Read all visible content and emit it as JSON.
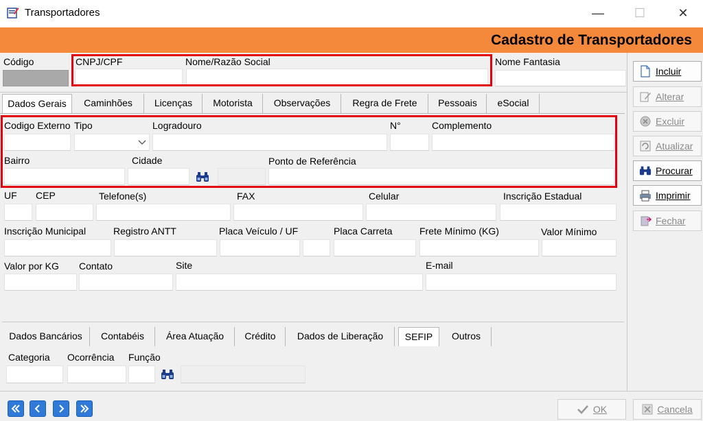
{
  "window": {
    "title": "Transportadores",
    "minimize": "—",
    "maximize": "☐",
    "close": "✕"
  },
  "header": {
    "title": "Cadastro de Transportadores"
  },
  "top_fields": {
    "codigo": "Código",
    "cnpj": "CNPJ/CPF",
    "nome": "Nome/Razão Social",
    "fantasia": "Nome Fantasia"
  },
  "tabs": [
    "Dados Gerais",
    "Caminhões",
    "Licenças",
    "Motorista",
    "Observações",
    "Regra de Frete",
    "Pessoais",
    "eSocial"
  ],
  "fields": {
    "codigo_externo": "Codigo Externo",
    "tipo": "Tipo",
    "logradouro": "Logradouro",
    "numero": "N°",
    "complemento": "Complemento",
    "bairro": "Bairro",
    "cidade": "Cidade",
    "ponto_referencia": "Ponto de Referência",
    "uf": "UF",
    "cep": "CEP",
    "telefone": "Telefone(s)",
    "fax": "FAX",
    "celular": "Celular",
    "inscricao_estadual": "Inscrição Estadual",
    "inscricao_municipal": "Inscrição Municipal",
    "registro_antt": "Registro ANTT",
    "placa_veiculo": "Placa Veículo / UF",
    "placa_carreta": "Placa Carreta",
    "frete_minimo": "Frete Mínimo (KG)",
    "valor_minimo": "Valor Mínimo",
    "valor_kg": "Valor por KG",
    "contato": "Contato",
    "site": "Site",
    "email": "E-mail"
  },
  "tabs2": [
    "Dados Bancários",
    "Contabéis",
    "Área Atuação",
    "Crédito",
    "Dados de Liberação",
    "SEFIP",
    "Outros"
  ],
  "sefip": {
    "categoria": "Categoria",
    "ocorrencia": "Ocorrência",
    "funcao": "Função"
  },
  "side_buttons": {
    "incluir": "Incluir",
    "alterar": "Alterar",
    "excluir": "Excluir",
    "atualizar": "Atualizar",
    "procurar": "Procurar",
    "imprimir": "Imprimir",
    "fechar": "Fechar"
  },
  "bottom_buttons": {
    "ok": "OK",
    "cancela": "Cancela"
  },
  "colors": {
    "header": "#f4893b",
    "highlight": "#e3000f",
    "nav": "#2f7ad8"
  }
}
